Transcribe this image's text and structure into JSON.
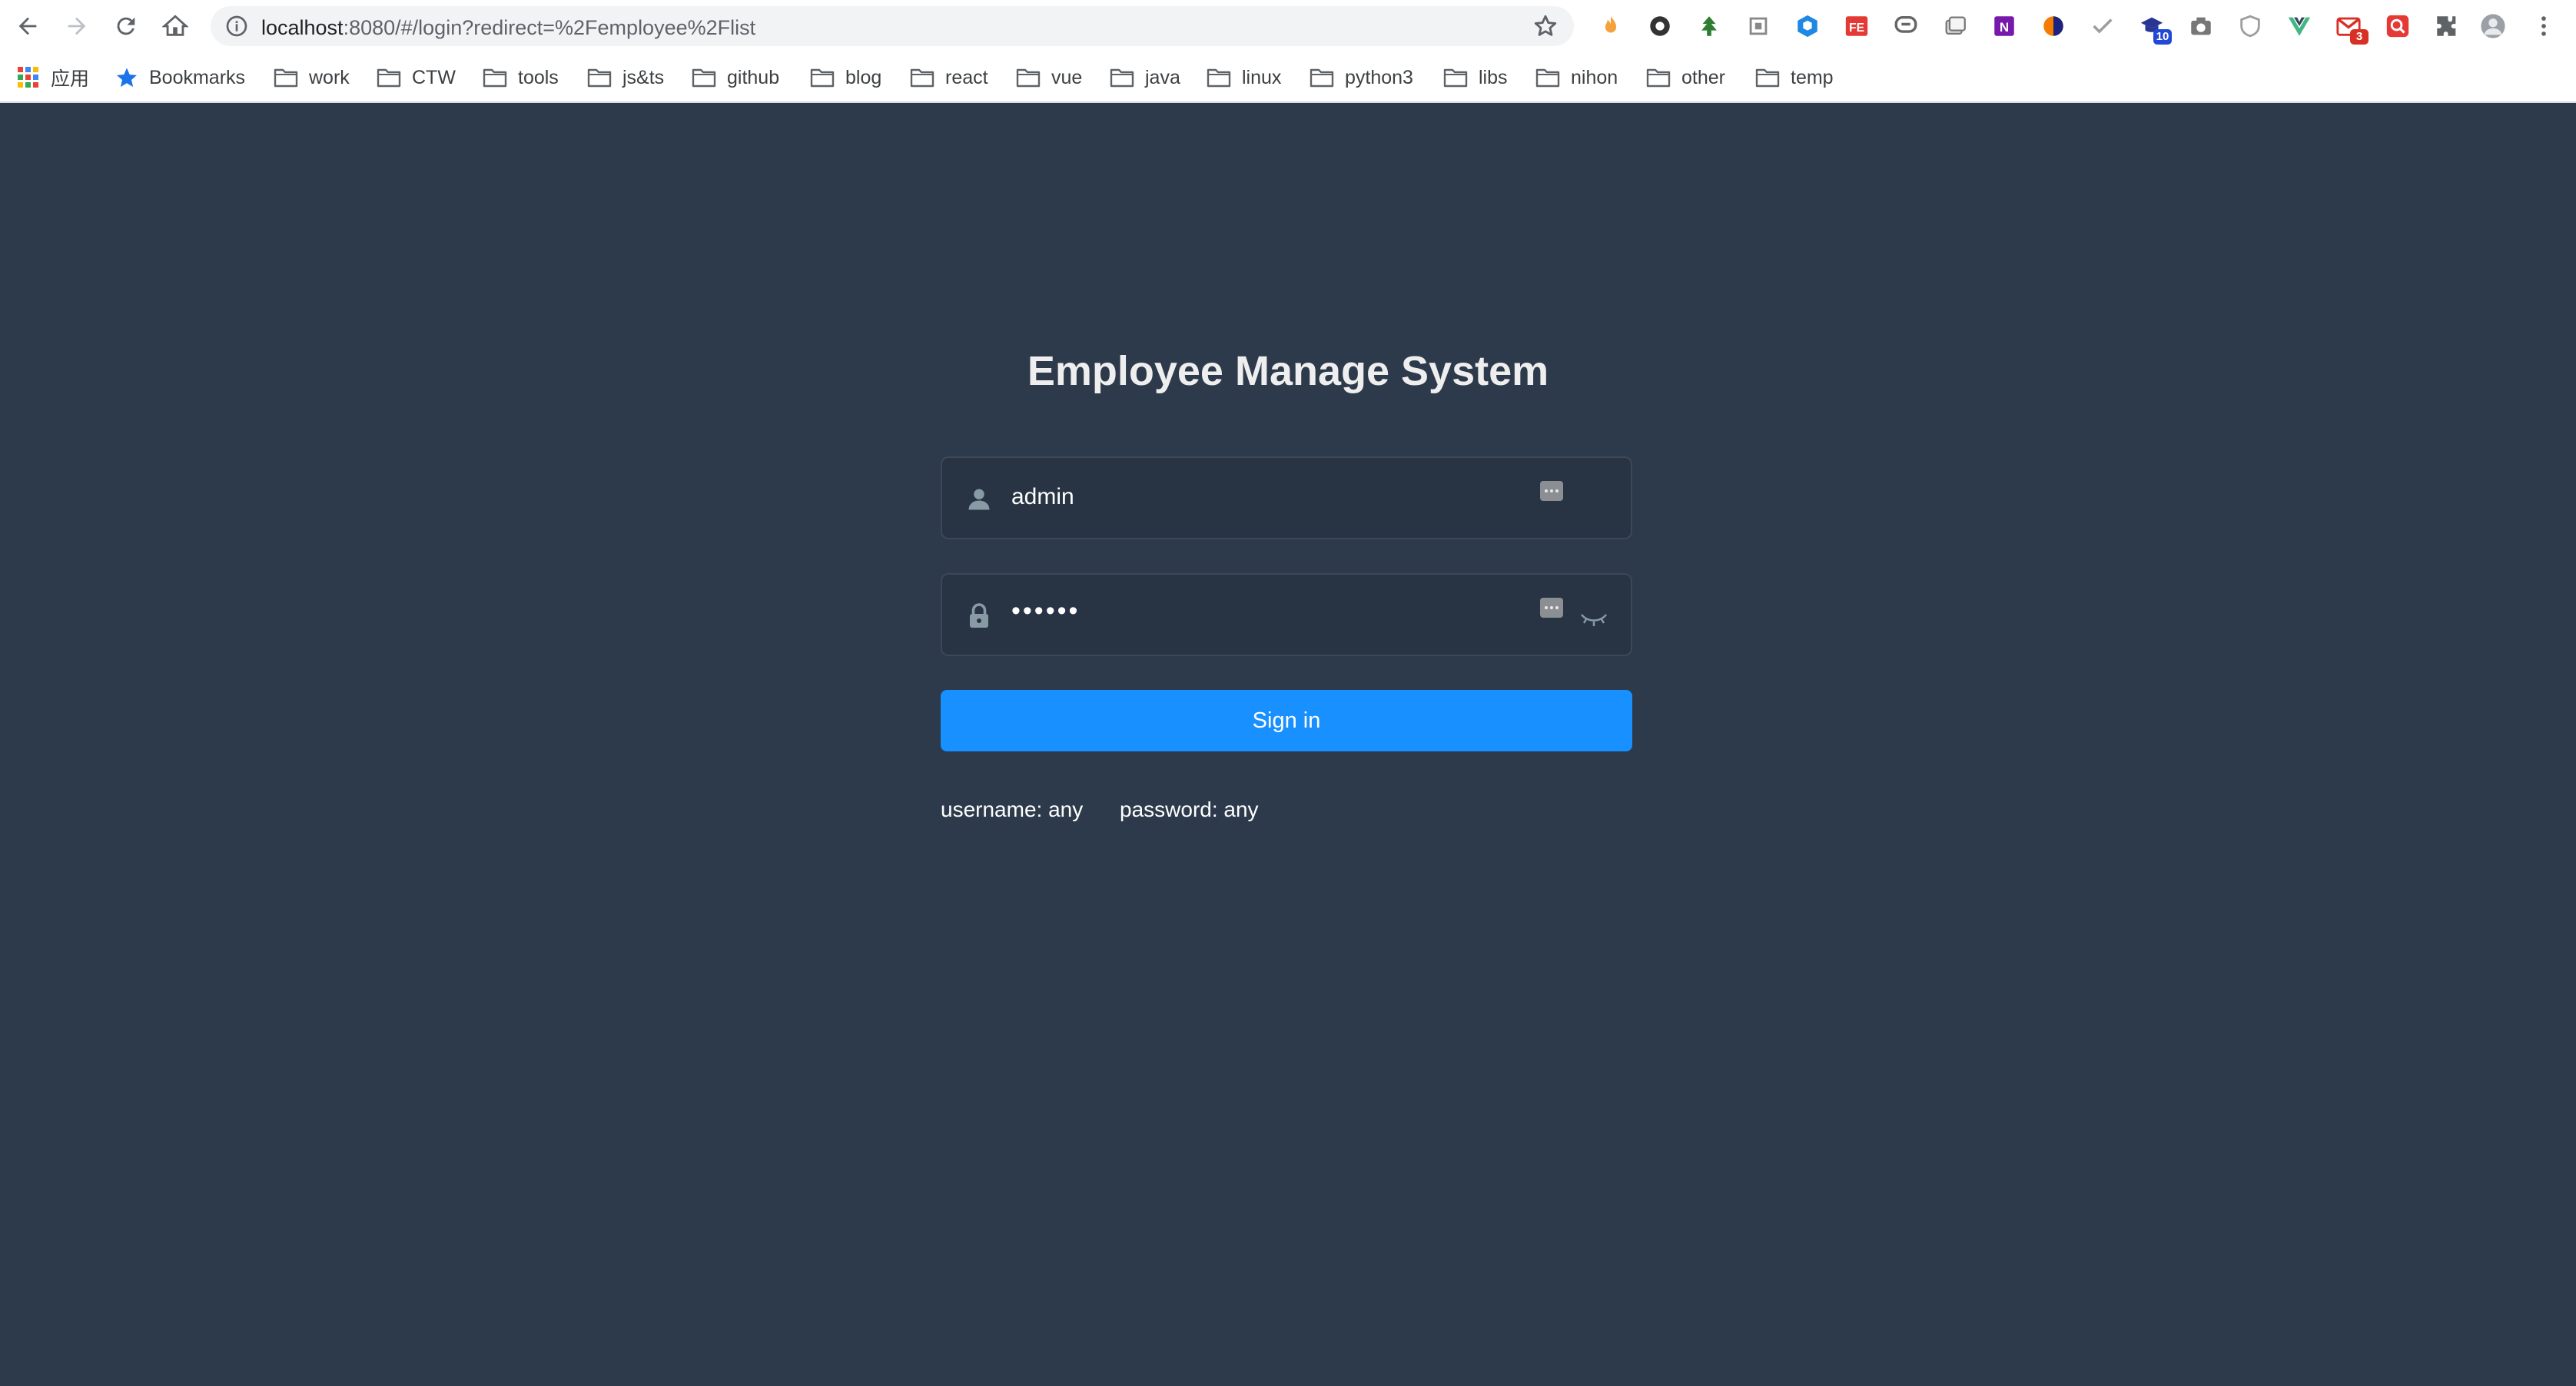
{
  "browser": {
    "url_host": "localhost",
    "url_rest": ":8080/#/login?redirect=%2Femployee%2Flist",
    "extensions": [
      {
        "name": "ext-fire-icon",
        "badge": ""
      },
      {
        "name": "ext-circle-icon",
        "badge": ""
      },
      {
        "name": "ext-green-icon",
        "badge": ""
      },
      {
        "name": "ext-box-icon",
        "badge": ""
      },
      {
        "name": "ext-hex-icon",
        "badge": ""
      },
      {
        "name": "ext-fe-icon",
        "badge": ""
      },
      {
        "name": "ext-chat-icon",
        "badge": ""
      },
      {
        "name": "ext-cards-icon",
        "badge": ""
      },
      {
        "name": "ext-onenote-icon",
        "badge": ""
      },
      {
        "name": "ext-orange-icon",
        "badge": ""
      },
      {
        "name": "ext-check-icon",
        "badge": ""
      },
      {
        "name": "ext-graduation-icon",
        "badge": "10"
      },
      {
        "name": "ext-camera-icon",
        "badge": ""
      },
      {
        "name": "ext-shield-icon",
        "badge": ""
      },
      {
        "name": "ext-vue-icon",
        "badge": ""
      },
      {
        "name": "ext-gmail-icon",
        "badge": "3"
      },
      {
        "name": "ext-search-icon",
        "badge": ""
      },
      {
        "name": "extensions-puzzle-icon",
        "badge": ""
      }
    ],
    "bookmarks": {
      "apps_label": "应用",
      "bookmarks_label": "Bookmarks",
      "folders": [
        "work",
        "CTW",
        "tools",
        "js&ts",
        "github",
        "blog",
        "react",
        "vue",
        "java",
        "linux",
        "python3",
        "libs",
        "nihon",
        "other",
        "temp"
      ]
    }
  },
  "login": {
    "title": "Employee Manage System",
    "username_value": "admin",
    "password_mask": "••••••",
    "signin_label": "Sign in",
    "tip_username": "username: any",
    "tip_password": "password: any"
  },
  "colors": {
    "page_bg": "#2d3a4b",
    "input_bg": "#283443",
    "button": "#1890ff",
    "title": "#eeeeee"
  }
}
